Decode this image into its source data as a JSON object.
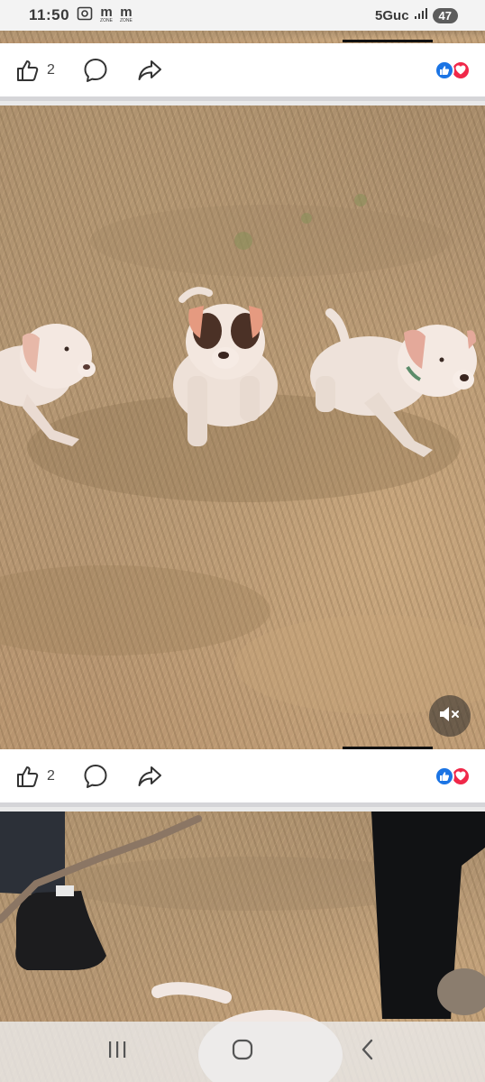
{
  "status_bar": {
    "time": "11:50",
    "zone_1": "m",
    "zone_1_caption": "ZONE",
    "zone_2": "m",
    "zone_2_caption": "ZONE",
    "network": "5Guc",
    "battery": "47"
  },
  "post_1": {
    "like_count": "2",
    "reactions": [
      "like-icon",
      "love-icon"
    ]
  },
  "video": {
    "muted": true
  },
  "post_2": {
    "like_count": "2",
    "reactions": [
      "like-icon",
      "love-icon"
    ]
  },
  "colors": {
    "like_blue": "#1b74e4",
    "love_red": "#f02849",
    "grass": "#b49674",
    "puppy_white": "#f1e4dc"
  }
}
